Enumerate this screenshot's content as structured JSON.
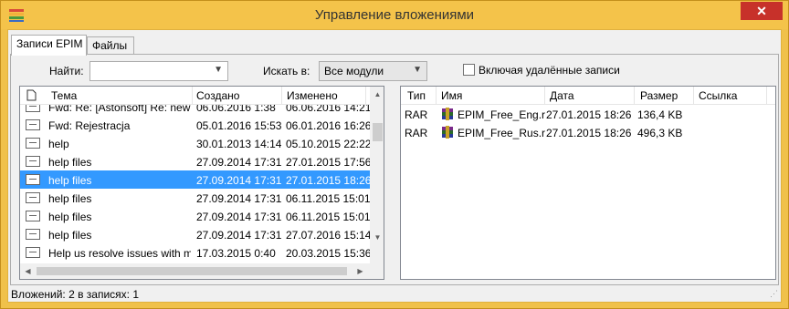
{
  "window": {
    "title": "Управление вложениями",
    "close_glyph": "✕"
  },
  "tabs": [
    {
      "label": "Записи EPIM"
    },
    {
      "label": "Файлы"
    }
  ],
  "filters": {
    "find_label": "Найти:",
    "find_value": "",
    "search_in_label": "Искать в:",
    "search_in_value": "Все модули",
    "include_deleted_label": "Включая удалённые записи",
    "include_deleted_checked": false
  },
  "records": {
    "columns": {
      "subject": "Тема",
      "created": "Создано",
      "modified": "Изменено"
    },
    "rows": [
      {
        "subject": "Fwd: Re: [Astonsoft] Re: new v",
        "created": "06.06.2016 1:38",
        "modified": "06.06.2016 14:21",
        "selected": false
      },
      {
        "subject": "Fwd: Rejestracja",
        "created": "05.01.2016 15:53",
        "modified": "06.01.2016 16:26",
        "selected": false
      },
      {
        "subject": "help",
        "created": "30.01.2013 14:14",
        "modified": "05.10.2015 22:22",
        "selected": false
      },
      {
        "subject": "help files",
        "created": "27.09.2014 17:31",
        "modified": "27.01.2015 17:56",
        "selected": false
      },
      {
        "subject": "help files",
        "created": "27.09.2014 17:31",
        "modified": "27.01.2015 18:26",
        "selected": true
      },
      {
        "subject": "help files",
        "created": "27.09.2014 17:31",
        "modified": "06.11.2015 15:01",
        "selected": false
      },
      {
        "subject": "help files",
        "created": "27.09.2014 17:31",
        "modified": "06.11.2015 15:01",
        "selected": false
      },
      {
        "subject": "help files",
        "created": "27.09.2014 17:31",
        "modified": "27.07.2016 15:14",
        "selected": false
      },
      {
        "subject": "Help us resolve issues with mo",
        "created": "17.03.2015 0:40",
        "modified": "20.03.2015 15:36",
        "selected": false
      }
    ]
  },
  "attachments": {
    "columns": {
      "type": "Тип",
      "name": "Имя",
      "date": "Дата",
      "size": "Размер",
      "link": "Ссылка"
    },
    "rows": [
      {
        "type": "RAR",
        "name": "EPIM_Free_Eng.ra",
        "date": "27.01.2015 18:26",
        "size": "136,4 KB",
        "link": ""
      },
      {
        "type": "RAR",
        "name": "EPIM_Free_Rus.rai",
        "date": "27.01.2015 18:26",
        "size": "496,3 KB",
        "link": ""
      }
    ]
  },
  "status": {
    "text": "Вложений: 2 в записях: 1"
  },
  "colors": {
    "titlebar": "#f4c34a",
    "selection": "#3399ff",
    "close": "#c7312a"
  },
  "icons": [
    "app-icon",
    "close-icon",
    "document-icon",
    "envelope-icon",
    "rar-archive-icon",
    "dropdown-arrow-icon",
    "scroll-arrow-icon"
  ]
}
